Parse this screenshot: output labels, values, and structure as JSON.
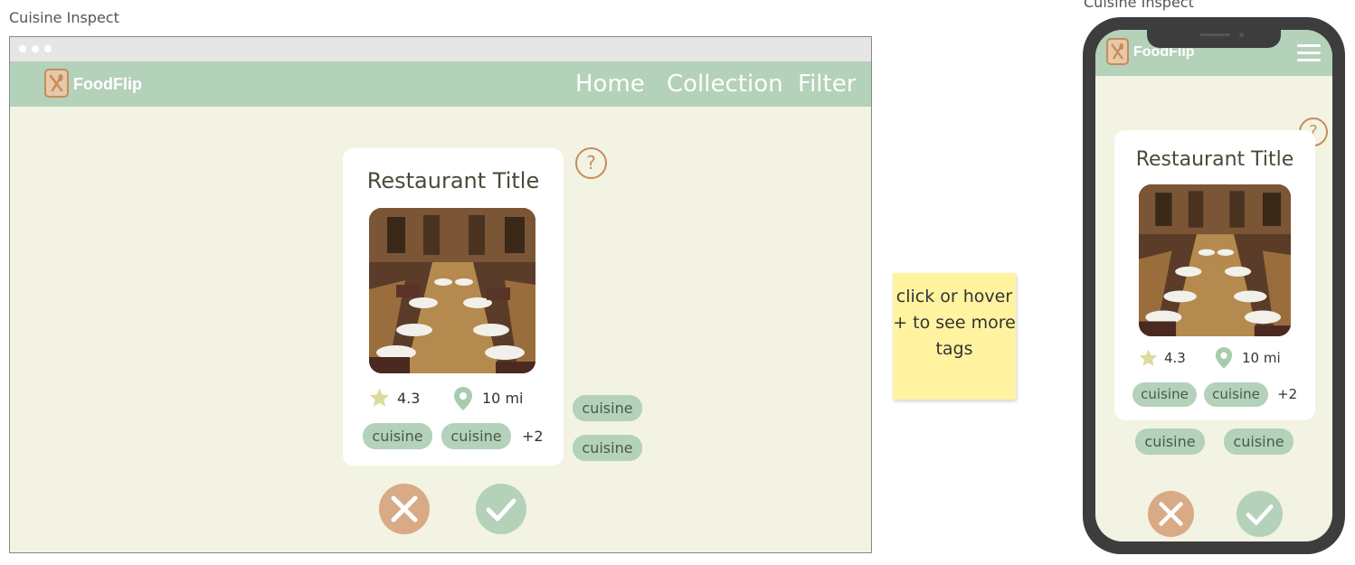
{
  "labels": {
    "desktop": "Cuisine Inspect",
    "mobile": "Cuisine Inspect"
  },
  "brand": {
    "name": "FoodFlip"
  },
  "nav": {
    "items": [
      "Home",
      "Collection",
      "Filter"
    ]
  },
  "card": {
    "title": "Restaurant Title",
    "rating": "4.3",
    "distance": "10 mi",
    "tags": [
      "cuisine",
      "cuisine"
    ],
    "more_tags": "+2",
    "extra_tags": [
      "cuisine",
      "cuisine"
    ]
  },
  "help": {
    "symbol": "?"
  },
  "sticky_note": {
    "text": "click or hover + to see more tags"
  },
  "icons": {
    "logo": "fork-knife-icon",
    "rating": "star-icon",
    "distance": "map-pin-icon",
    "reject": "close-icon",
    "accept": "check-icon",
    "menu": "hamburger-menu-icon"
  },
  "colors": {
    "nav_bg": "#b4d1b9",
    "page_bg": "#f3f3e3",
    "accent_brown": "#c68c5c",
    "reject_bg": "#d9aa86",
    "accept_bg": "#b4d1b9",
    "tag_bg": "#b4d1b9",
    "star": "#d9dc9e",
    "pin": "#a8ccae",
    "sticky": "#fff3a0"
  }
}
